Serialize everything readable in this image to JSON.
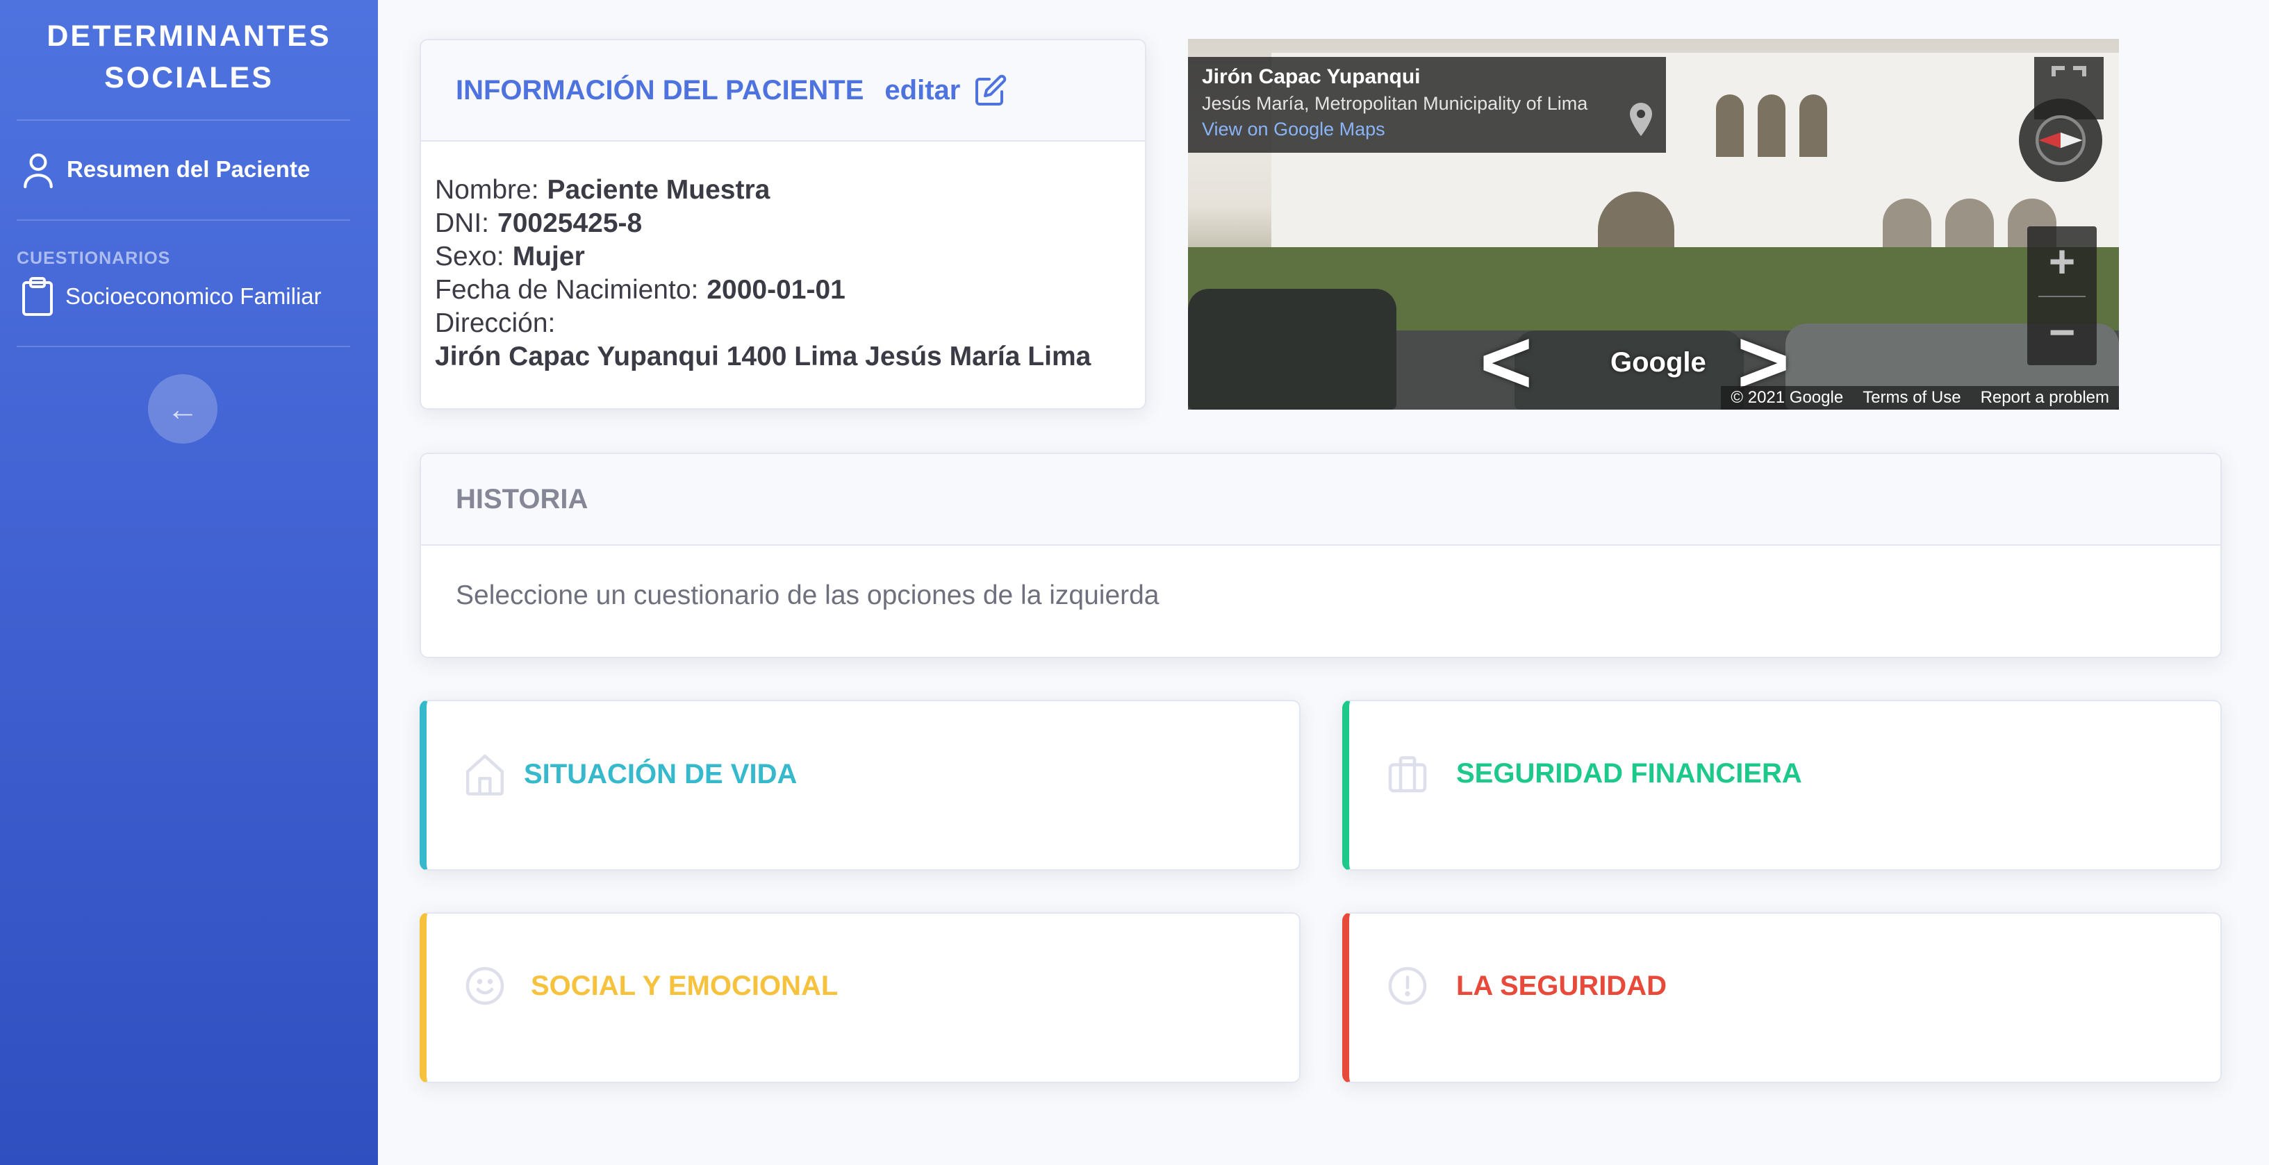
{
  "sidebar": {
    "brand_line1": "DETERMINANTES",
    "brand_line2": "SOCIALES",
    "nav_summary": "Resumen del Paciente",
    "section_heading": "CUESTIONARIOS",
    "nav_questionnaire": "Socioeconomico Familiar",
    "collapse_glyph": "←"
  },
  "patient": {
    "header_title": "INFORMACIÓN DEL PACIENTE",
    "edit_label": "editar",
    "name_label": "Nombre:",
    "name_value": "Paciente Muestra",
    "dni_label": "DNI:",
    "dni_value": "70025425-8",
    "sex_label": "Sexo:",
    "sex_value": "Mujer",
    "dob_label": "Fecha de Nacimiento:",
    "dob_value": "2000-01-01",
    "address_label": "Dirección:",
    "address_value": "Jirón Capac Yupanqui 1400 Lima Jesús María Lima"
  },
  "streetview": {
    "place_title": "Jirón Capac Yupanqui",
    "place_subtitle": "Jesús María, Metropolitan Municipality of Lima",
    "view_link": "View on Google Maps",
    "google_logo": "Google",
    "copyright": "© 2021 Google",
    "terms": "Terms of Use",
    "report": "Report a problem",
    "zoom_in": "+",
    "zoom_out": "−",
    "arrow_left": "<",
    "arrow_right": ">"
  },
  "history": {
    "title": "HISTORIA",
    "message": "Seleccione un cuestionario de las opciones de la izquierda"
  },
  "categories": [
    {
      "label": "SITUACIÓN DE VIDA",
      "color": "#36b9cc",
      "icon": "house-icon"
    },
    {
      "label": "SEGURIDAD FINANCIERA",
      "color": "#1cc88a",
      "icon": "briefcase-icon"
    },
    {
      "label": "SOCIAL Y EMOCIONAL",
      "color": "#f6c23e",
      "icon": "smile-icon"
    },
    {
      "label": "LA SEGURIDAD",
      "color": "#e74a3b",
      "icon": "alert-circle-icon"
    }
  ]
}
